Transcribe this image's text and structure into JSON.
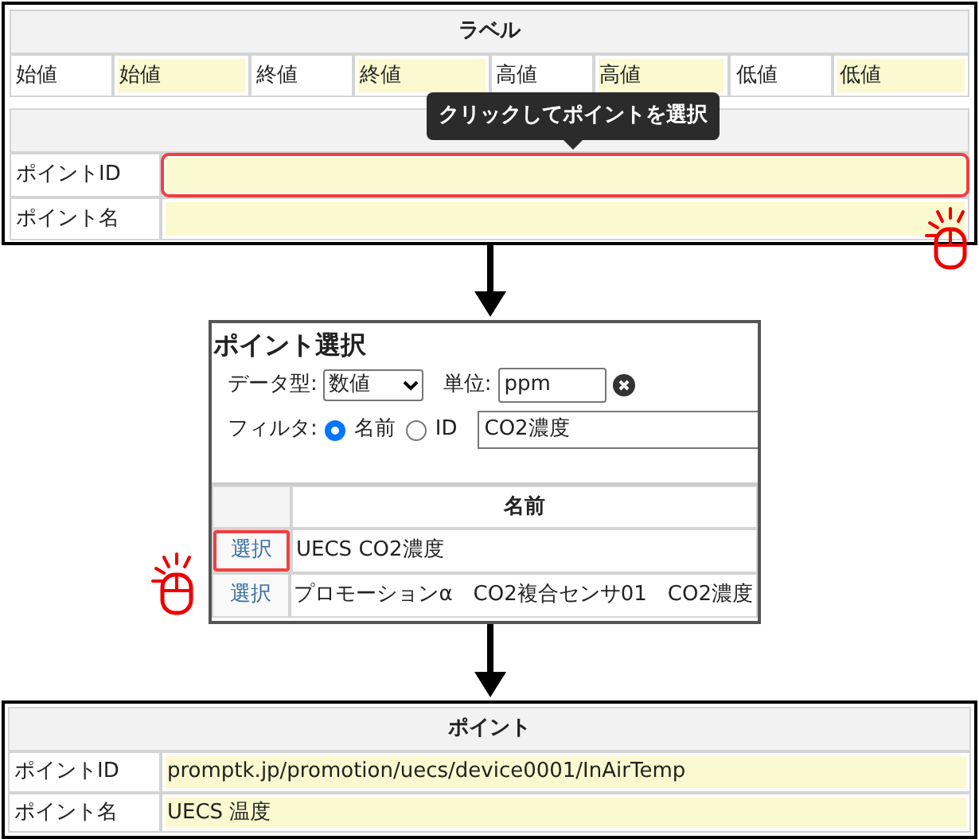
{
  "label_table": {
    "title": "ラベル",
    "fields": [
      {
        "label": "始値",
        "value": "始値"
      },
      {
        "label": "終値",
        "value": "終値"
      },
      {
        "label": "高値",
        "value": "高値"
      },
      {
        "label": "低値",
        "value": "低値"
      }
    ]
  },
  "point_table": {
    "rows": [
      {
        "label": "ポイントID",
        "highlighted": true
      },
      {
        "label": "ポイント名",
        "highlighted": false
      }
    ]
  },
  "tooltip": {
    "text": "クリックしてポイントを選択"
  },
  "dialog": {
    "title": "ポイント選択",
    "data_type": {
      "label": "データ型:",
      "value": "数値"
    },
    "unit": {
      "label": "単位:",
      "value": "ppm"
    },
    "filter": {
      "label": "フィルタ:",
      "options": [
        {
          "label": "名前",
          "selected": true
        },
        {
          "label": "ID",
          "selected": false
        }
      ],
      "value": "CO2濃度"
    },
    "table": {
      "columns": [
        "名前"
      ],
      "rows": [
        {
          "action": "選択",
          "name": "UECS CO2濃度",
          "highlighted": true
        },
        {
          "action": "選択",
          "name": "プロモーションα　CO2複合センサ01　CO2濃度",
          "highlighted": false
        }
      ]
    }
  },
  "result_table": {
    "title": "ポイント",
    "rows": [
      {
        "label": "ポイントID",
        "value": "promptk.jp/promotion/uecs/device0001/InAirTemp"
      },
      {
        "label": "ポイント名",
        "value": "UECS 温度"
      }
    ]
  }
}
